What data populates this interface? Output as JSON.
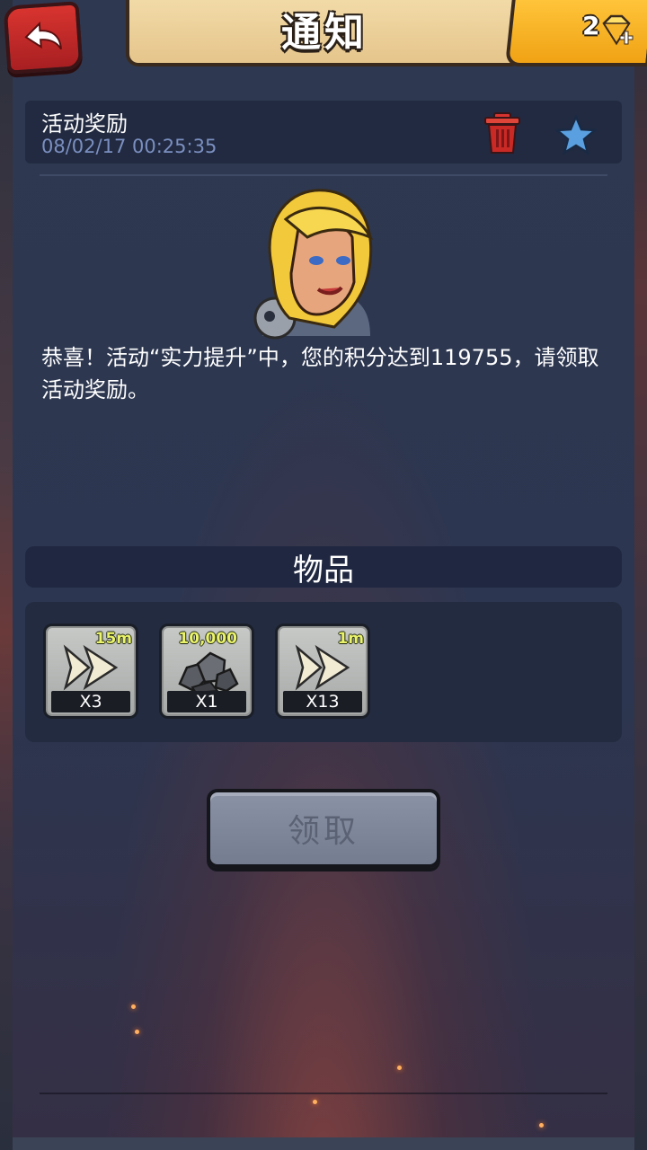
{
  "header": {
    "title": "通知",
    "gem_count": "2"
  },
  "notice": {
    "title": "活动奖励",
    "timestamp": "08/02/17 00:25:35",
    "message": "恭喜！活动“实力提升”中，您的积分达到119755，请领取活动奖励。"
  },
  "items_section": {
    "heading": "物品",
    "items": [
      {
        "icon": "speedup-arrow-icon",
        "badge": "15m",
        "quantity": "X3"
      },
      {
        "icon": "stone-resource-icon",
        "badge": "10,000",
        "quantity": "X1"
      },
      {
        "icon": "speedup-arrow-icon",
        "badge": "1m",
        "quantity": "X13"
      }
    ]
  },
  "actions": {
    "claim_label": "领取"
  },
  "colors": {
    "background": "#2c3650",
    "accent_gold": "#f0a214",
    "back_button": "#d8342f",
    "star": "#5aa0e0",
    "timestamp": "#7b8fc0"
  }
}
